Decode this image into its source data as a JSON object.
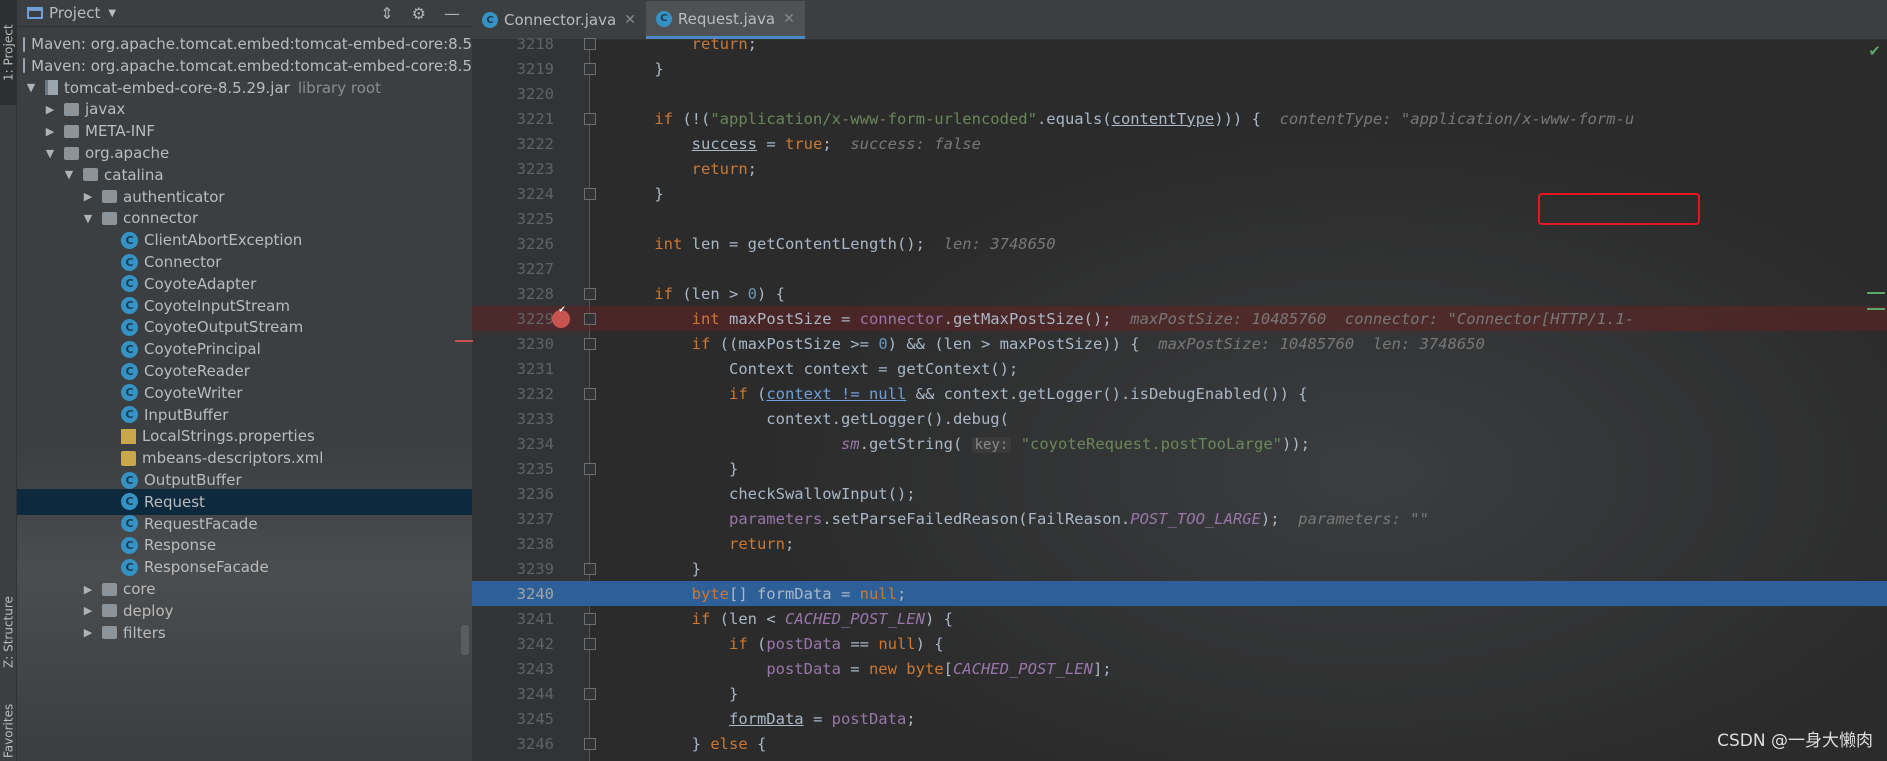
{
  "sidebar_tabs": {
    "project": "1: Project",
    "structure": "Z: Structure",
    "favorites": "Favorites"
  },
  "project_panel": {
    "title": "Project",
    "tree": [
      {
        "label": "Maven: org.apache.tomcat.embed:tomcat-embed-core:8.5",
        "icon": "library-icon",
        "depth": 0,
        "arrow": ""
      },
      {
        "label": "Maven: org.apache.tomcat.embed:tomcat-embed-core:8.5",
        "icon": "library-icon",
        "depth": 0,
        "arrow": ""
      },
      {
        "label": "tomcat-embed-core-8.5.29.jar",
        "suffix": "library root",
        "icon": "jar-icon",
        "depth": 0,
        "arrow": "down"
      },
      {
        "label": "javax",
        "icon": "package-icon",
        "depth": 1,
        "arrow": "right"
      },
      {
        "label": "META-INF",
        "icon": "package-icon",
        "depth": 1,
        "arrow": "right"
      },
      {
        "label": "org.apache",
        "icon": "package-icon",
        "depth": 1,
        "arrow": "down"
      },
      {
        "label": "catalina",
        "icon": "package-icon",
        "depth": 2,
        "arrow": "down"
      },
      {
        "label": "authenticator",
        "icon": "package-icon",
        "depth": 3,
        "arrow": "right"
      },
      {
        "label": "connector",
        "icon": "package-icon",
        "depth": 3,
        "arrow": "down"
      },
      {
        "label": "ClientAbortException",
        "icon": "exception-class-icon",
        "depth": 4,
        "arrow": ""
      },
      {
        "label": "Connector",
        "icon": "class-icon",
        "depth": 4,
        "arrow": ""
      },
      {
        "label": "CoyoteAdapter",
        "icon": "class-icon",
        "depth": 4,
        "arrow": ""
      },
      {
        "label": "CoyoteInputStream",
        "icon": "class-icon",
        "depth": 4,
        "arrow": ""
      },
      {
        "label": "CoyoteOutputStream",
        "icon": "class-icon",
        "depth": 4,
        "arrow": ""
      },
      {
        "label": "CoyotePrincipal",
        "icon": "class-icon",
        "depth": 4,
        "arrow": ""
      },
      {
        "label": "CoyoteReader",
        "icon": "class-icon",
        "depth": 4,
        "arrow": ""
      },
      {
        "label": "CoyoteWriter",
        "icon": "class-icon",
        "depth": 4,
        "arrow": ""
      },
      {
        "label": "InputBuffer",
        "icon": "class-icon",
        "depth": 4,
        "arrow": ""
      },
      {
        "label": "LocalStrings.properties",
        "icon": "properties-file-icon",
        "depth": 4,
        "arrow": ""
      },
      {
        "label": "mbeans-descriptors.xml",
        "icon": "xml-file-icon",
        "depth": 4,
        "arrow": ""
      },
      {
        "label": "OutputBuffer",
        "icon": "class-icon",
        "depth": 4,
        "arrow": ""
      },
      {
        "label": "Request",
        "icon": "class-icon",
        "depth": 4,
        "arrow": "",
        "selected": true
      },
      {
        "label": "RequestFacade",
        "icon": "class-icon",
        "depth": 4,
        "arrow": ""
      },
      {
        "label": "Response",
        "icon": "class-icon",
        "depth": 4,
        "arrow": ""
      },
      {
        "label": "ResponseFacade",
        "icon": "class-icon",
        "depth": 4,
        "arrow": ""
      },
      {
        "label": "core",
        "icon": "package-icon",
        "depth": 3,
        "arrow": "right"
      },
      {
        "label": "deploy",
        "icon": "package-icon",
        "depth": 3,
        "arrow": "right"
      },
      {
        "label": "filters",
        "icon": "package-icon",
        "depth": 3,
        "arrow": "right"
      }
    ]
  },
  "editor": {
    "tabs": [
      {
        "label": "Connector.java",
        "active": false
      },
      {
        "label": "Request.java",
        "active": true
      }
    ],
    "lines": [
      {
        "n": "3218",
        "fold": true,
        "html": "        <span class=\"kw\">return</span>;"
      },
      {
        "n": "3219",
        "fold": true,
        "html": "    }"
      },
      {
        "n": "3220",
        "fold": false,
        "html": ""
      },
      {
        "n": "3221",
        "fold": true,
        "html": "    <span class=\"kw\">if</span> (!(<span class=\"str\">\"application/x-www-form-urlencoded\"</span>.equals(<span class=\"ul\">contentType</span>))) {  <span class=\"hint\">contentType: \"application/x-www-form-u</span>"
      },
      {
        "n": "3222",
        "fold": false,
        "html": "        <span class=\"ul\">success</span> = <span class=\"kw\">true</span>;  <span class=\"hint\">success: false</span>"
      },
      {
        "n": "3223",
        "fold": false,
        "html": "        <span class=\"kw\">return</span>;"
      },
      {
        "n": "3224",
        "fold": true,
        "html": "    }"
      },
      {
        "n": "3225",
        "fold": false,
        "html": ""
      },
      {
        "n": "3226",
        "fold": false,
        "html": "    <span class=\"kw\">int</span> len = getContentLength();  <span class=\"hint\">len: 3748650</span>"
      },
      {
        "n": "3227",
        "fold": false,
        "html": ""
      },
      {
        "n": "3228",
        "fold": true,
        "html": "    <span class=\"kw\">if</span> (len &gt; <span class=\"num\">0</span>) {"
      },
      {
        "n": "3229",
        "fold": true,
        "bp": true,
        "html": "        <span class=\"kw\">int</span> maxPostSize = <span class=\"fld\">connector</span>.getMaxPostSize();  <span class=\"hint\">maxPostSize: 10485760  connector: \"Connector[HTTP/1.1-</span>"
      },
      {
        "n": "3230",
        "fold": true,
        "html": "        <span class=\"kw\">if</span> ((maxPostSize &gt;= <span class=\"num\">0</span>) &amp;&amp; (len &gt; maxPostSize)) {  <span class=\"hint\">maxPostSize: 10485760  len: 3748650</span>"
      },
      {
        "n": "3231",
        "fold": false,
        "html": "            Context context = getContext();"
      },
      {
        "n": "3232",
        "fold": true,
        "html": "            <span class=\"kw\">if</span> (<span class=\"ulbl\">context != null</span> &amp;&amp; context.getLogger().isDebugEnabled()) {"
      },
      {
        "n": "3233",
        "fold": false,
        "html": "                context.getLogger().debug("
      },
      {
        "n": "3234",
        "fold": false,
        "html": "                        <span class=\"cst\">sm</span>.getString( <span class=\"plabel\">key:</span> <span class=\"str\">\"coyoteRequest.postTooLarge\"</span>));"
      },
      {
        "n": "3235",
        "fold": true,
        "html": "            }"
      },
      {
        "n": "3236",
        "fold": false,
        "html": "            checkSwallowInput();"
      },
      {
        "n": "3237",
        "fold": false,
        "html": "            <span class=\"fld\">parameters</span>.setParseFailedReason(FailReason.<span class=\"cst\">POST_TOO_LARGE</span>);  <span class=\"hint\">parameters: \"\"</span>"
      },
      {
        "n": "3238",
        "fold": false,
        "html": "            <span class=\"kw\">return</span>;"
      },
      {
        "n": "3239",
        "fold": true,
        "html": "        }"
      },
      {
        "n": "3240",
        "fold": false,
        "cur": true,
        "html": "        <span class=\"kw\">byte</span>[] formData = <span class=\"kw\">null</span>;"
      },
      {
        "n": "3241",
        "fold": true,
        "html": "        <span class=\"kw\">if</span> (len &lt; <span class=\"cst\">CACHED_POST_LEN</span>) {"
      },
      {
        "n": "3242",
        "fold": true,
        "html": "            <span class=\"kw\">if</span> (<span class=\"fld\">postData</span> == <span class=\"kw\">null</span>) {"
      },
      {
        "n": "3243",
        "fold": false,
        "html": "                <span class=\"fld\">postData</span> = <span class=\"kw\">new byte</span>[<span class=\"cst\">CACHED_POST_LEN</span>];"
      },
      {
        "n": "3244",
        "fold": true,
        "html": "            }"
      },
      {
        "n": "3245",
        "fold": false,
        "html": "            <span class=\"ul\">formData</span> = <span class=\"fld\">postData</span>;"
      },
      {
        "n": "3246",
        "fold": true,
        "html": "        } <span class=\"kw\">else</span> {"
      }
    ]
  },
  "watermark": "CSDN @一身大懒肉"
}
